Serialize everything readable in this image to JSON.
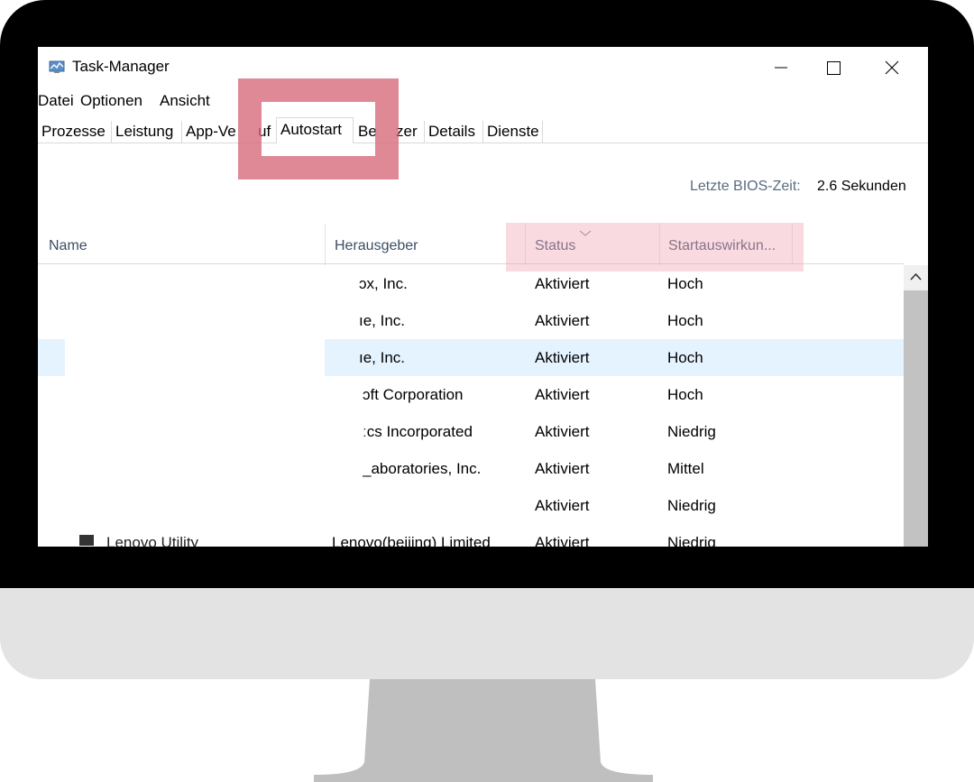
{
  "window": {
    "title": "Task-Manager",
    "icon": "task-manager-icon",
    "controls": [
      "minimize-icon",
      "maximize-icon",
      "close-icon"
    ]
  },
  "menu": [
    "Datei",
    "Optionen",
    "Ansicht"
  ],
  "tabs": [
    {
      "label": "Prozesse"
    },
    {
      "label": "Leistung"
    },
    {
      "label": "App-Ve"
    },
    {
      "label": "uf"
    },
    {
      "label": "Autostart",
      "active": true
    },
    {
      "label": "Be"
    },
    {
      "label": "zer"
    },
    {
      "label": "Details"
    },
    {
      "label": "Dienste"
    }
  ],
  "bios": {
    "label": "Letzte BIOS-Zeit:",
    "value": "2.6 Sekunden"
  },
  "columns": {
    "name": "Name",
    "publisher": "Herausgeber",
    "status": "Status",
    "impact": "Startauswirkun..."
  },
  "rows": [
    {
      "name": "",
      "publisher": "ɔx, Inc.",
      "status": "Aktiviert",
      "impact": "Hoch"
    },
    {
      "name": "",
      "publisher": "ıe, Inc.",
      "status": "Aktiviert",
      "impact": "Hoch"
    },
    {
      "name": "",
      "publisher": "ıe, Inc.",
      "status": "Aktiviert",
      "impact": "Hoch",
      "selected": true
    },
    {
      "name": "",
      "publisher": "ɔft Corporation",
      "status": "Aktiviert",
      "impact": "Hoch"
    },
    {
      "name": "",
      "publisher": "ːcs Incorporated",
      "status": "Aktiviert",
      "impact": "Niedrig"
    },
    {
      "name": "",
      "publisher": "_aboratories, Inc.",
      "status": "Aktiviert",
      "impact": "Mittel"
    },
    {
      "name": "",
      "publisher": "",
      "status": "Aktiviert",
      "impact": "Niedrig"
    },
    {
      "name": "Lenovo Utility",
      "publisher": "Lenovo(beijing) Limited",
      "status": "Aktiviert",
      "impact": "Niedrig"
    }
  ],
  "colors": {
    "highlight_tab": "#d66779",
    "highlight_columns": "#f0a8b4",
    "selected_row": "#e5f3ff",
    "bezel": "#000000",
    "chin": "#e3e3e3",
    "stand": "#bfbfbf"
  }
}
